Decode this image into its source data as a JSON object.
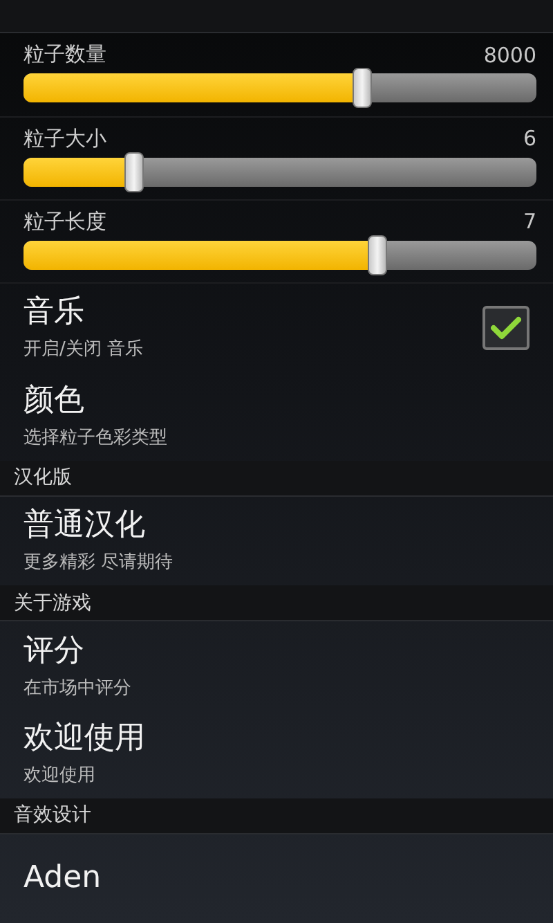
{
  "sections": [
    {
      "items": [
        {
          "kind": "slider",
          "title": "粒子数量",
          "reading": "8000",
          "level": 0.66
        },
        {
          "kind": "slider",
          "title": "粒子大小",
          "reading": "6",
          "level": 0.215
        },
        {
          "kind": "slider",
          "title": "粒子长度",
          "reading": "7",
          "level": 0.69
        },
        {
          "kind": "checkbox",
          "title": "音乐",
          "summary": "开启/关闭 音乐",
          "checked": true
        },
        {
          "kind": "plain",
          "title": "颜色",
          "summary": "选择粒子色彩类型"
        }
      ]
    },
    {
      "header": "汉化版",
      "items": [
        {
          "kind": "plain",
          "title": "普通汉化",
          "summary": "更多精彩 尽请期待"
        }
      ]
    },
    {
      "header": "关于游戏",
      "items": [
        {
          "kind": "plain",
          "title": "评分",
          "summary": "在市场中评分"
        },
        {
          "kind": "plain",
          "title": "欢迎使用",
          "summary": "欢迎使用"
        }
      ]
    },
    {
      "header": "音效设计",
      "items": [
        {
          "kind": "plain",
          "title": "Aden"
        }
      ]
    }
  ]
}
